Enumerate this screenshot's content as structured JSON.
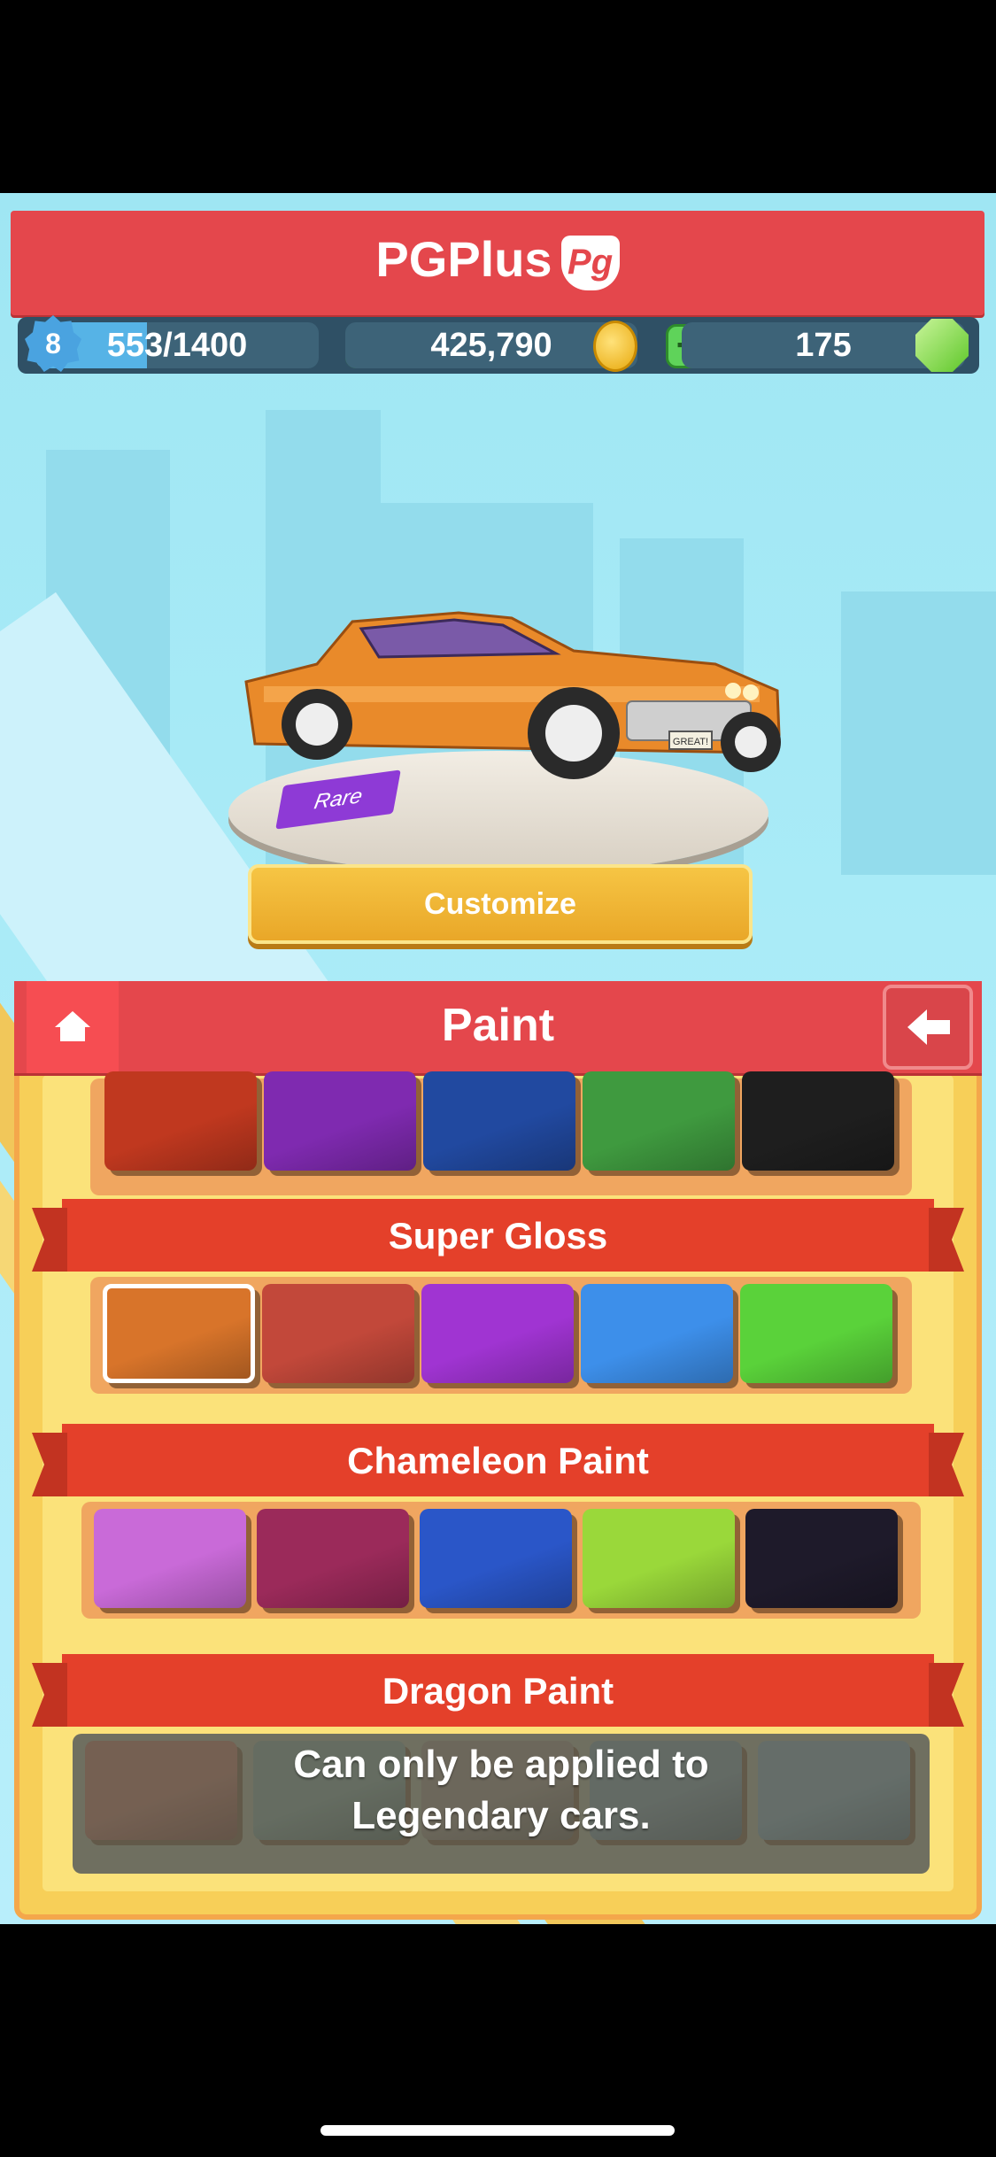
{
  "header": {
    "app_title": "PGPlus",
    "logo_text": "Pg"
  },
  "stats": {
    "level": "8",
    "xp_text": "553/1400",
    "xp_progress": 0.395,
    "coins": "425,790",
    "gems": "175"
  },
  "car": {
    "rarity_tag": "Rare",
    "plate_text": "GREAT!",
    "customize_label": "Customize"
  },
  "panel": {
    "title": "Paint",
    "sections": [
      {
        "label": "",
        "colors": [
          "#c0381f",
          "#7f2ab0",
          "#2149a0",
          "#3f9a3f",
          "#1e1e1e"
        ]
      },
      {
        "label": "Super Gloss",
        "colors": [
          "#d8742a",
          "#c2483a",
          "#a034d2",
          "#3d8fea",
          "#5ad23a"
        ]
      },
      {
        "label": "Chameleon Paint",
        "colors": [
          "#c96ad8",
          "#9b2a5a",
          "#2a56c8",
          "#9ad83a",
          "#1e1a2a"
        ]
      },
      {
        "label": "Dragon Paint",
        "colors": [
          "#7a5548",
          "#5d6a62",
          "#6a6258",
          "#5a6668",
          "#5d6d72"
        ]
      }
    ],
    "locked_message_line1": "Can only be applied to",
    "locked_message_line2": "Legendary cars."
  }
}
